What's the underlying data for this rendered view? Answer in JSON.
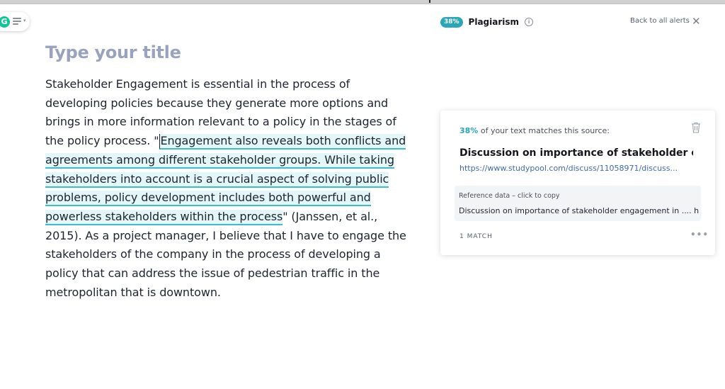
{
  "editor": {
    "title_placeholder": "Type your title",
    "paragraph": {
      "before": "Stakeholder Engagement is essential in the process of developing policies because they generate more options and brings in more information relevant to a policy in the stages of the policy process. \"",
      "highlighted": "Engagement also reveals both conflicts and agreements among different stakeholder groups. While taking stakeholders into account is a crucial aspect of solving public problems, policy development includes both powerful and powerless stakeholders within the process",
      "after": "\" (Janssen, et al., 2015).  As a project manager, I believe that I have to engage the stakeholders of the company in the process of developing a policy that can address the issue of pedestrian traffic in the metropolitan that is downtown."
    }
  },
  "sidebar": {
    "percentage": "38%",
    "title": "Plagiarism",
    "back_link": "Back to all alerts"
  },
  "alert_card": {
    "match_percent": "38%",
    "match_text": "of your text matches this source:",
    "source_title": "Discussion on importance of stakeholder eng",
    "source_url": "https://www.studypool.com/discuss/11058971/discuss...",
    "reference_label": "Reference data – click to copy",
    "reference_text": "Discussion on importance of stakeholder engagement in .... h...",
    "match_count": "1 MATCH"
  },
  "icons": {
    "logo": "grammarly-g-icon",
    "menu": "hamburger-icon",
    "info": "info-icon",
    "close": "close-icon",
    "trash": "trash-icon",
    "more": "more-icon"
  },
  "colors": {
    "accent": "#2ba6b8",
    "highlight_bg": "#e3f7f8",
    "highlight_underline": "#3cbec4",
    "title_placeholder": "#9aa3bd",
    "link": "#3d6bb3"
  }
}
